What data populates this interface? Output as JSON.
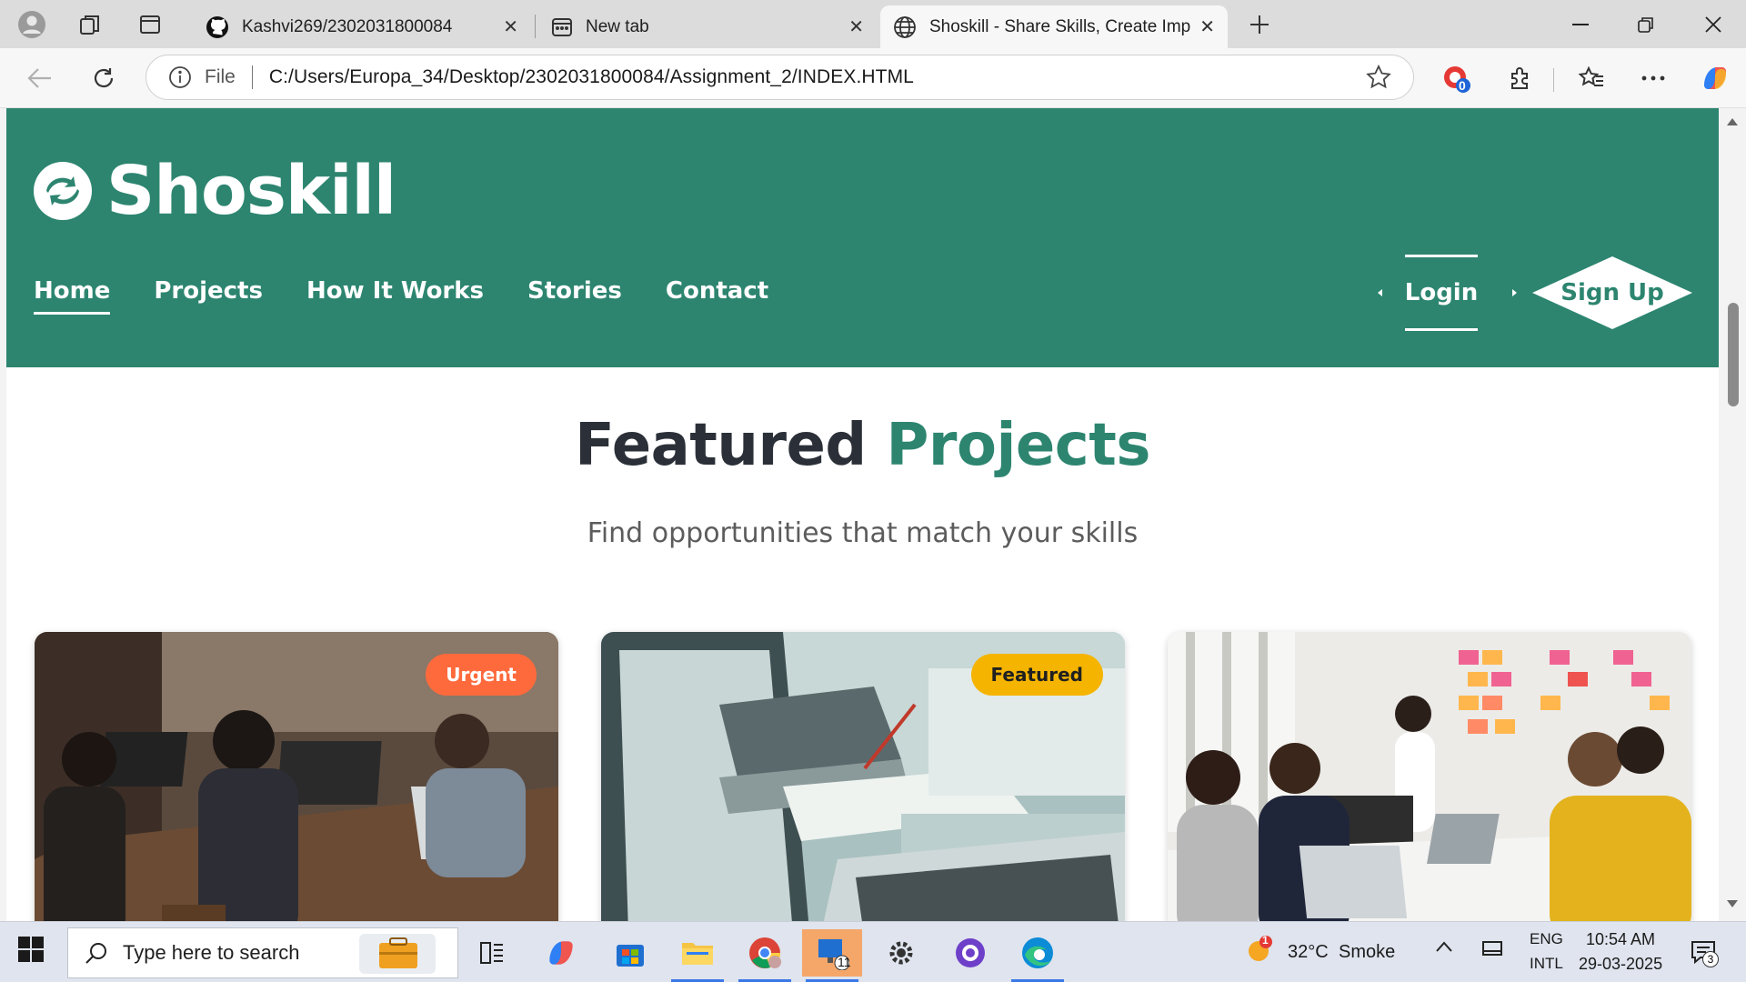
{
  "browser": {
    "tabs": [
      {
        "label": "Kashvi269/2302031800084",
        "icon": "github-icon",
        "active": false
      },
      {
        "label": "New tab",
        "icon": "newtab-icon",
        "active": false
      },
      {
        "label": "Shoskill - Share Skills, Create Imp",
        "icon": "globe-icon",
        "active": true
      }
    ],
    "url_scheme": "File",
    "url": "C:/Users/Europa_34/Desktop/2302031800084/Assignment_2/INDEX.HTML",
    "extension_badge": "0"
  },
  "site": {
    "logo_text": "Shoskill",
    "nav": [
      "Home",
      "Projects",
      "How It Works",
      "Stories",
      "Contact"
    ],
    "login_label": "Login",
    "signup_label": "Sign Up",
    "section_title_a": "Featured",
    "section_title_b": "Projects",
    "section_subtitle": "Find opportunities that match your skills",
    "cards": [
      {
        "badge": "Urgent",
        "badge_color": "#ff6a3d"
      },
      {
        "badge": "Featured",
        "badge_color": "#f5b400"
      },
      {
        "badge": "",
        "badge_color": ""
      }
    ],
    "brand_color": "#2d8570"
  },
  "taskbar": {
    "search_placeholder": "Type here to search",
    "weather_temp": "32°C",
    "weather_desc": "Smoke",
    "weather_badge": "1",
    "lang_top": "ENG",
    "lang_bottom": "INTL",
    "time": "10:54 AM",
    "date": "29-03-2025",
    "notification_count": "3",
    "app_badge": "11"
  }
}
